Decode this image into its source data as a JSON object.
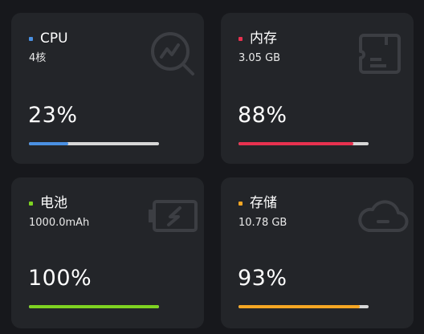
{
  "cards": {
    "cpu": {
      "title": "CPU",
      "subtitle": "4核",
      "percent_label": "23%",
      "usage": 0.3,
      "accent": "#4a90e2",
      "icon": "chart-search-icon"
    },
    "memory": {
      "title": "内存",
      "subtitle": "3.05 GB",
      "percent_label": "88%",
      "usage": 0.88,
      "accent": "#e8314f",
      "icon": "memory-card-icon"
    },
    "battery": {
      "title": "电池",
      "subtitle": "1000.0mAh",
      "percent_label": "100%",
      "usage": 1.0,
      "accent": "#7ed321",
      "icon": "battery-charging-icon"
    },
    "storage": {
      "title": "存储",
      "subtitle": "10.78 GB",
      "percent_label": "93%",
      "usage": 0.93,
      "accent": "#f5a623",
      "icon": "cloud-storage-icon"
    }
  }
}
